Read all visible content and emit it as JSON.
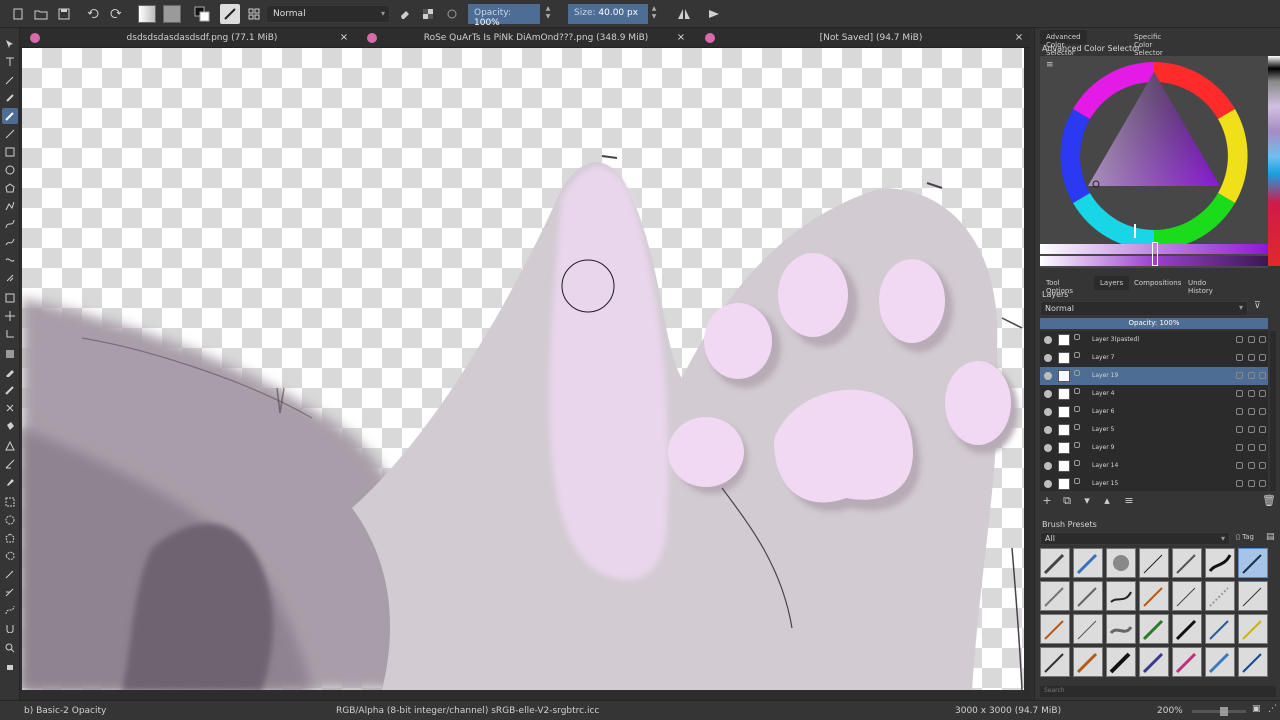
{
  "toolbar": {
    "blend_mode": "Normal",
    "opacity_label": "Opacity:",
    "opacity_value": "100%",
    "size_label": "Size:",
    "size_value": "40.00 px"
  },
  "tabs": [
    {
      "title": "dsdsdsdasdasdsdf.png (77.1 MiB)"
    },
    {
      "title": "RoSe QuArTs Is PiNk DiAmOnd???.png (348.9 MiB)"
    },
    {
      "title": "[Not Saved]  (94.7 MiB)"
    }
  ],
  "dock": {
    "top_tabs": [
      "Advanced Color Selector",
      "Specific Color Selector"
    ],
    "color_title": "Advanced Color Selector",
    "mid_tabs": [
      "Tool Options",
      "Layers",
      "Compositions",
      "Undo History"
    ],
    "layers_title": "Layers",
    "layers_blend": "Normal",
    "layers_opacity": "Opacity: 100%",
    "layers": [
      {
        "name": "Layer 3(pasted)"
      },
      {
        "name": "Layer 7"
      },
      {
        "name": "Layer 19",
        "selected": true
      },
      {
        "name": "Layer 4"
      },
      {
        "name": "Layer 6"
      },
      {
        "name": "Layer 5"
      },
      {
        "name": "Layer 9"
      },
      {
        "name": "Layer 14"
      },
      {
        "name": "Layer 15"
      }
    ],
    "brush_presets_title": "Brush Presets",
    "brush_filter": "All",
    "brush_tag": "Tag",
    "brush_search": "Search"
  },
  "status": {
    "brush": "b) Basic-2 Opacity",
    "color_space": "RGB/Alpha (8-bit integer/channel)  sRGB-elle-V2-srgbtrc.icc",
    "image_size": "3000 x 3000 (94.7 MiB)",
    "zoom": "200%"
  },
  "colors": {
    "accent": "#4d6d94",
    "canvas_fur": "#d2cbd2",
    "paw_pad": "#f1d9f3",
    "shadow": "#6e6370"
  }
}
